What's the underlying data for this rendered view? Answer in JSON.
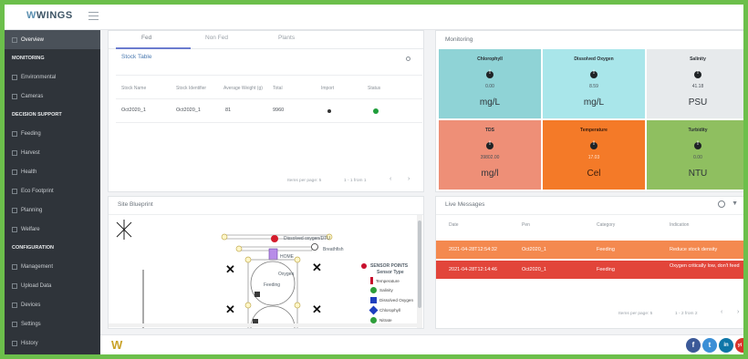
{
  "header": {
    "logo": "WINGS",
    "logo_mark": "W"
  },
  "sidebar": {
    "items": [
      {
        "label": "Overview",
        "type": "item",
        "active": true
      },
      {
        "label": "MONITORING",
        "type": "section"
      },
      {
        "label": "Environmental",
        "type": "item"
      },
      {
        "label": "Cameras",
        "type": "item"
      },
      {
        "label": "DECISION SUPPORT",
        "type": "section"
      },
      {
        "label": "Feeding",
        "type": "item"
      },
      {
        "label": "Harvest",
        "type": "item"
      },
      {
        "label": "Health",
        "type": "item"
      },
      {
        "label": "Eco Footprint",
        "type": "item"
      },
      {
        "label": "Planning",
        "type": "item"
      },
      {
        "label": "Welfare",
        "type": "item"
      },
      {
        "label": "CONFIGURATION",
        "type": "section"
      },
      {
        "label": "Management",
        "type": "item"
      },
      {
        "label": "Upload Data",
        "type": "item"
      },
      {
        "label": "Devices",
        "type": "item"
      },
      {
        "label": "Settings",
        "type": "item"
      },
      {
        "label": "History",
        "type": "item"
      }
    ]
  },
  "stock": {
    "tabs": [
      "Fed",
      "Non Fed",
      "Plants"
    ],
    "title": "Stock Table",
    "columns": [
      "Stock Name",
      "Stock Identifier",
      "Average Weight (g)",
      "Total",
      "Import",
      "Status"
    ],
    "row": {
      "name": "Oct2020_1",
      "identifier": "Oct2020_1",
      "weight": "81",
      "total": "9960"
    },
    "pager": {
      "per_page": "Items per page: 5",
      "range": "1 - 1 from 1"
    }
  },
  "monitoring": {
    "title": "Monitoring",
    "tiles": [
      {
        "name": "Chlorophyll",
        "value": "0.00",
        "unit": "mg/L",
        "color": "#8fd3d6"
      },
      {
        "name": "Dissolved Oxygen",
        "value": "8.59",
        "unit": "mg/L",
        "color": "#a9e6ea"
      },
      {
        "name": "Salinity",
        "value": "41.18",
        "unit": "PSU",
        "color": "#e7eaec"
      },
      {
        "name": "TDS",
        "value": "39802.00",
        "unit": "mg/l",
        "color": "#ee8f77"
      },
      {
        "name": "Temperature",
        "value": "17.03",
        "unit": "Cel",
        "color": "#f47a28"
      },
      {
        "name": "Turbidity",
        "value": "0.00",
        "unit": "NTU",
        "color": "#8fbf60"
      }
    ]
  },
  "blueprint": {
    "title": "Site Blueprint",
    "labels": {
      "sensor1": "Dissolved oxygen/DTU",
      "sensor2": "Breathfish",
      "sensor3": "HOME",
      "sensor4": "Oxygen",
      "feeding": "Feeding"
    },
    "legend": {
      "title": "SENSOR POINTS",
      "subtitle": "Sensor Type",
      "items": [
        {
          "label": "Temperature",
          "color": "#c8102e"
        },
        {
          "label": "Salinity",
          "color": "#2e9e3a"
        },
        {
          "label": "Dissolved Oxygen",
          "color": "#1f3fbf"
        },
        {
          "label": "Chlorophyll",
          "color": "#1f3fbf"
        },
        {
          "label": "Nitrate",
          "color": "#2e9e3a"
        }
      ]
    }
  },
  "messages": {
    "title": "Live Messages",
    "columns": [
      "Date",
      "Pen",
      "Category",
      "Indication"
    ],
    "rows": [
      {
        "date": "2021-04-28T12:54:32",
        "pen": "Oct2020_1",
        "category": "Feeding",
        "indication": "Reduce stock density",
        "color": "#f4894f"
      },
      {
        "date": "2021-04-28T12:14:46",
        "pen": "Oct2020_1",
        "category": "Feeding",
        "indication": "Oxygen critically low, don't feed",
        "color": "#e2453a"
      }
    ],
    "pager": {
      "per_page": "Items per page: 5",
      "range": "1 - 2 from 2"
    }
  },
  "footer": {
    "logo": "W",
    "social": [
      "f",
      "t",
      "in",
      "yt"
    ]
  }
}
